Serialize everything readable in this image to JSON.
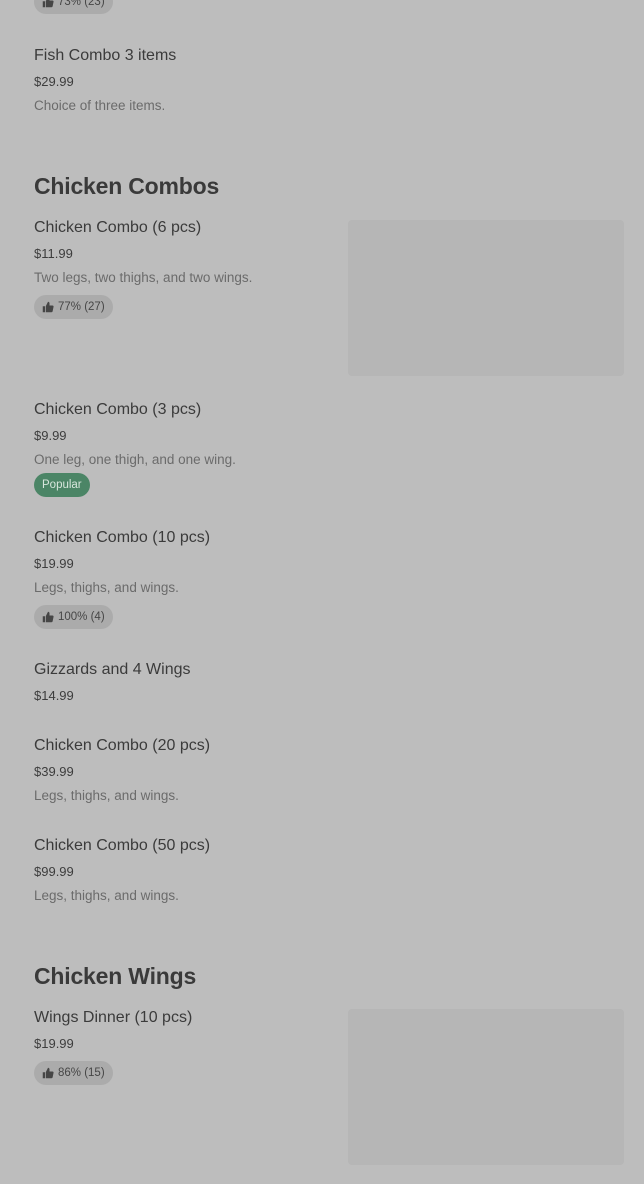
{
  "colors": {
    "background": "#bdbdbd",
    "popular_badge": "#4b8566",
    "rating_pill": "#ababab"
  },
  "top_partial_rating": "73% (23)",
  "items_before": [
    {
      "name": "Fish Combo 3 items",
      "price": "$29.99",
      "description": "Choice of three items."
    }
  ],
  "sections": [
    {
      "title": "Chicken Combos",
      "items": [
        {
          "name": "Chicken Combo (6 pcs)",
          "price": "$11.99",
          "description": "Two legs, two thighs, and two wings.",
          "rating": "77% (27)"
        },
        {
          "name": "Chicken Combo (3 pcs)",
          "price": "$9.99",
          "description": "One leg, one thigh, and one wing.",
          "badge": "Popular"
        },
        {
          "name": "Chicken Combo (10 pcs)",
          "price": "$19.99",
          "description": "Legs, thighs, and wings.",
          "rating": "100% (4)"
        },
        {
          "name": "Gizzards and 4 Wings",
          "price": "$14.99"
        },
        {
          "name": "Chicken Combo (20 pcs)",
          "price": "$39.99",
          "description": "Legs, thighs, and wings."
        },
        {
          "name": "Chicken Combo (50 pcs)",
          "price": "$99.99",
          "description": "Legs, thighs, and wings."
        }
      ]
    },
    {
      "title": "Chicken Wings",
      "items": [
        {
          "name": "Wings Dinner (10 pcs)",
          "price": "$19.99",
          "rating": "86% (15)"
        }
      ]
    }
  ],
  "icons": {
    "rating": "thumbs-up-icon"
  }
}
